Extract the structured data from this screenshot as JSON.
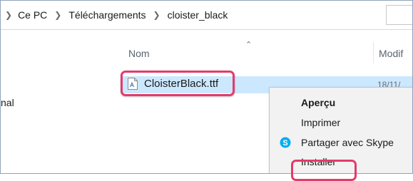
{
  "breadcrumb": {
    "items": [
      "Ce PC",
      "Téléchargements",
      "cloister_black"
    ]
  },
  "nav_pane": {
    "partial_label": "nal"
  },
  "columns": {
    "name": "Nom",
    "modified": "Modif"
  },
  "file": {
    "name": "CloisterBlack.ttf",
    "date_partial": "18/11/"
  },
  "context_menu": {
    "items": [
      {
        "label": "Aperçu",
        "default": true
      },
      {
        "label": "Imprimer"
      },
      {
        "label": "Partager avec Skype",
        "icon": "skype-icon"
      },
      {
        "label": "Installer",
        "highlighted": true
      }
    ]
  },
  "colors": {
    "highlight": "#e33b6a",
    "selection": "#cce8ff",
    "skype": "#00aff0"
  }
}
